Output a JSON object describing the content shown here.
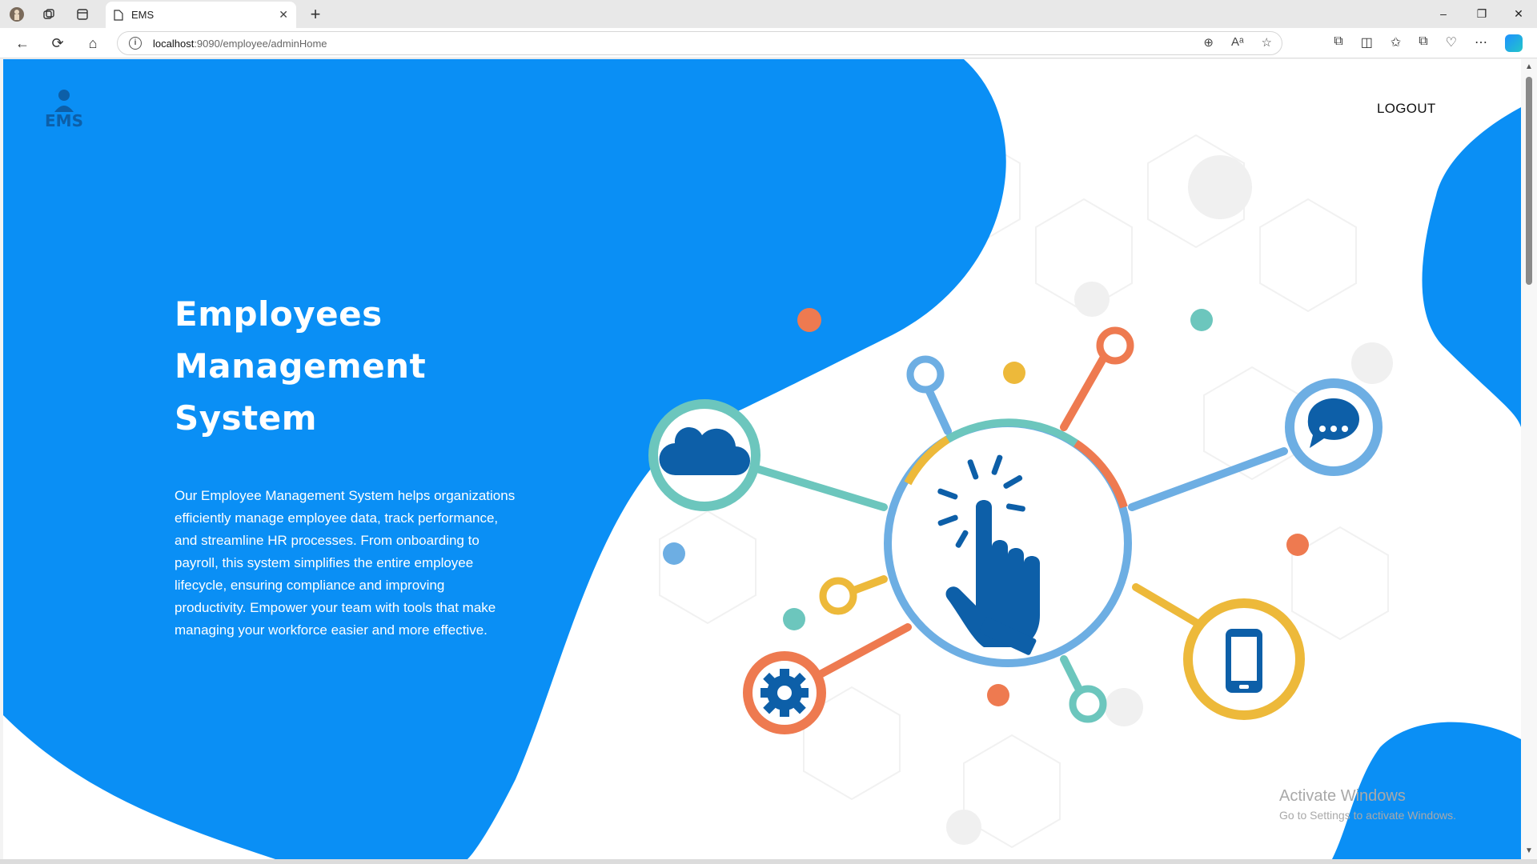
{
  "browser": {
    "tab_title": "EMS",
    "url_host": "localhost",
    "url_path": ":9090/employee/adminHome",
    "icons": {
      "back": "←",
      "refresh": "⟳",
      "home": "⌂",
      "zoom": "⊕",
      "read_aloud": "Aᵃ",
      "favorite": "☆",
      "extensions": "⧉",
      "split": "◫",
      "favorites_bar": "✩",
      "collections": "⧉",
      "copilot": "",
      "more": "⋯",
      "new_tab": "+",
      "close": "✕",
      "minimize": "–",
      "restore": "❐",
      "win_close": "✕"
    }
  },
  "page": {
    "logo_text": "EMS",
    "logout_label": "LOGOUT",
    "hero_title_1": "Employees",
    "hero_title_2": "Management",
    "hero_title_3": "System",
    "hero_description": "Our Employee Management System helps organizations efficiently manage employee data, track performance, and streamline HR processes. From onboarding to payroll, this system simplifies the entire employee lifecycle, ensuring compliance and improving productivity. Empower your team with tools that make managing your workforce easier and more effective.",
    "watermark_title": "Activate Windows",
    "watermark_subtitle": "Go to Settings to activate Windows."
  },
  "colors": {
    "brand_blue": "#0a8ff5",
    "dark_blue": "#0d5fa8",
    "teal": "#6cc6bd",
    "orange": "#ee7a50",
    "yellow": "#edb93a",
    "light_blue": "#6daee3"
  }
}
